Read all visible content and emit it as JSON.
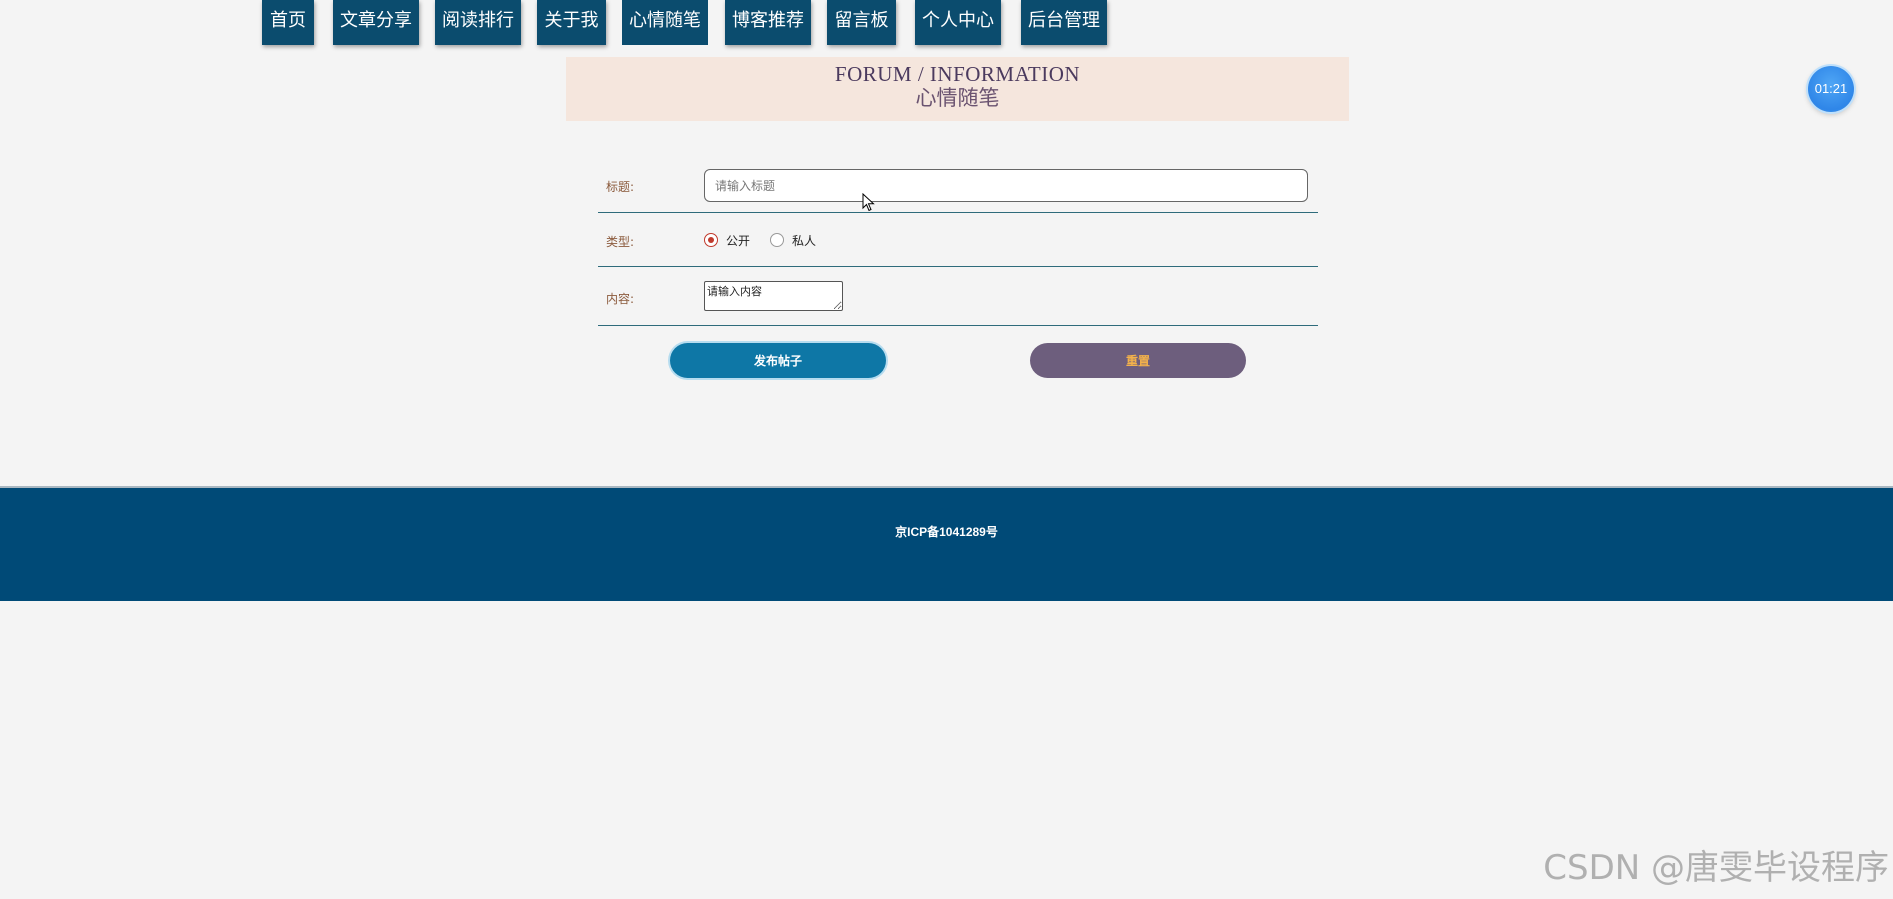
{
  "nav": {
    "items": [
      {
        "label": "首页"
      },
      {
        "label": "文章分享"
      },
      {
        "label": "阅读排行"
      },
      {
        "label": "关于我"
      },
      {
        "label": "心情随笔"
      },
      {
        "label": "博客推荐"
      },
      {
        "label": "留言板"
      },
      {
        "label": "个人中心"
      },
      {
        "label": "后台管理"
      }
    ],
    "active": "心情随笔"
  },
  "banner": {
    "english": "FORUM / INFORMATION",
    "chinese": "心情随笔"
  },
  "timer": {
    "text": "01:21"
  },
  "form": {
    "title_label": "标题:",
    "title_placeholder": "请输入标题",
    "title_value": "",
    "type_label": "类型:",
    "type_options": [
      {
        "label": "公开",
        "checked": true
      },
      {
        "label": "私人",
        "checked": false
      }
    ],
    "content_label": "内容:",
    "content_placeholder": "请输入内容",
    "submit_label": "发布帖子",
    "reset_label": "重置"
  },
  "footer": {
    "icp": "京ICP备1041289号"
  },
  "watermark": "CSDN @唐雯毕设程序",
  "colors": {
    "nav_bg": "#0b4c6e",
    "banner_bg": "#f5e6dd",
    "footer_bg": "#004a77",
    "submit_bg": "#0e77a6",
    "reset_bg": "#6d5e7d",
    "reset_text": "#f3b24b",
    "radio_checked": "#c0392b"
  }
}
